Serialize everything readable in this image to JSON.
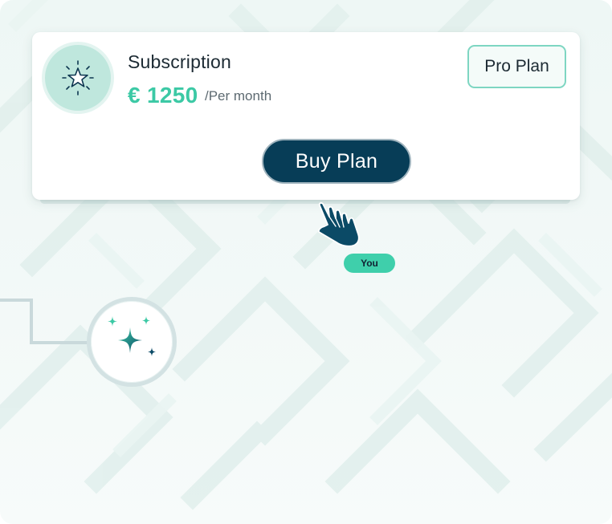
{
  "card": {
    "title": "Subscription",
    "price": "€ 1250",
    "period": "/Per month",
    "plan_badge": "Pro Plan",
    "buy_label": "Buy Plan"
  },
  "cursor": {
    "tag": "You"
  },
  "colors": {
    "accent": "#3cc9a5",
    "button": "#073d57",
    "badge_bg": "#bfe7dd",
    "tag_bg": "#3fcfab"
  },
  "icons": {
    "card_icon": "star-burst-icon",
    "cursor_icon": "pointing-hand-icon",
    "node_icon": "sparkles-icon"
  }
}
